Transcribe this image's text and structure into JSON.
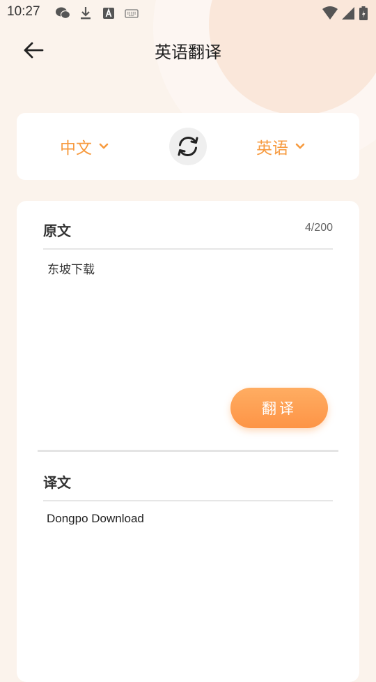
{
  "status_bar": {
    "time": "10:27",
    "left_icons": [
      "wechat-icon",
      "download-icon",
      "font-app-icon",
      "keyboard-icon"
    ],
    "right_icons": [
      "wifi-icon",
      "signal-icon",
      "battery-icon"
    ]
  },
  "app_bar": {
    "back_icon": "arrow-left-icon",
    "title": "英语翻译"
  },
  "languages": {
    "source": "中文",
    "target": "英语",
    "swap_icon": "swap-icon",
    "accent_color": "#f79a3e"
  },
  "source": {
    "label": "原文",
    "count": "4/200",
    "text": "东坡下载"
  },
  "translate_button": "翻译",
  "result": {
    "label": "译文",
    "text": "Dongpo Download"
  }
}
